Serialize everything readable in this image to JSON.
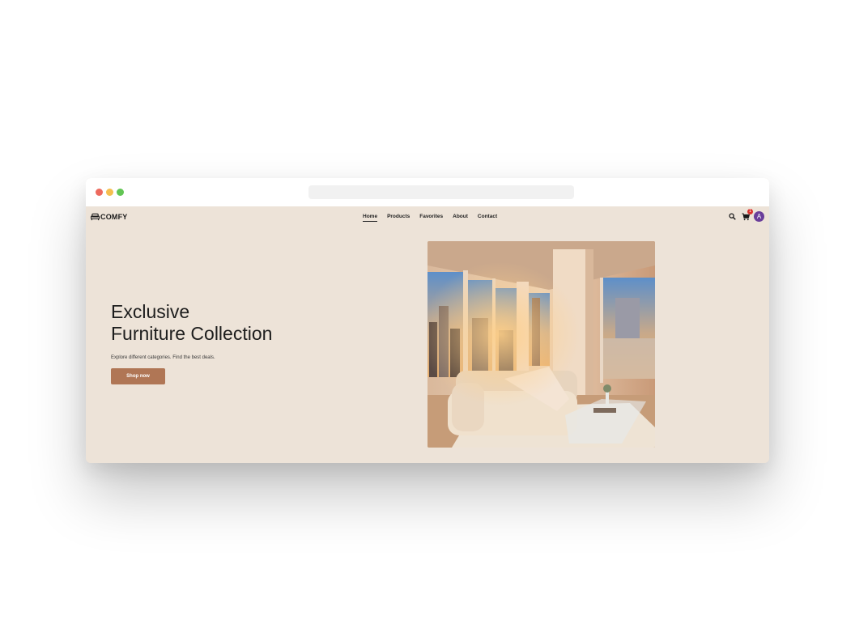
{
  "brand": {
    "name": "COMFY",
    "logo_icon": "sofa-icon"
  },
  "nav": {
    "links": [
      {
        "label": "Home",
        "active": true
      },
      {
        "label": "Products",
        "active": false
      },
      {
        "label": "Favorites",
        "active": false
      },
      {
        "label": "About",
        "active": false
      },
      {
        "label": "Contact",
        "active": false
      }
    ],
    "icons": {
      "search": "search-icon",
      "cart": "cart-icon"
    },
    "cart_count": "1",
    "avatar_initial": "A"
  },
  "hero": {
    "title_line1": "Exclusive",
    "title_line2": "Furniture Collection",
    "subtitle": "Explore different categories. Find the best deals.",
    "cta_label": "Shop now"
  },
  "colors": {
    "page_bg": "#ede3d8",
    "cta": "#b07655",
    "avatar": "#6a3d9a",
    "badge": "#d9322e"
  }
}
